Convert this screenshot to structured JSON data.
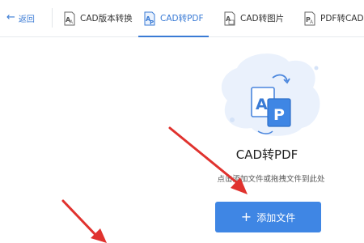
{
  "nav": {
    "back_label": "返回",
    "tabs": [
      {
        "label": "CAD版本转换",
        "icon": "cad-version-icon"
      },
      {
        "label": "CAD转PDF",
        "icon": "cad-to-pdf-icon",
        "active": true
      },
      {
        "label": "CAD转图片",
        "icon": "cad-to-image-icon"
      },
      {
        "label": "PDF转CAD",
        "icon": "pdf-to-cad-icon"
      }
    ]
  },
  "main": {
    "illustration_letters": [
      "A",
      "P"
    ],
    "title": "CAD转PDF",
    "hint": "点击添加文件或拖拽文件到此处",
    "add_button_label": "添加文件"
  },
  "colors": {
    "accent": "#3a7bd5",
    "button": "#3f86e4",
    "annotation_arrow": "#e0322e"
  }
}
